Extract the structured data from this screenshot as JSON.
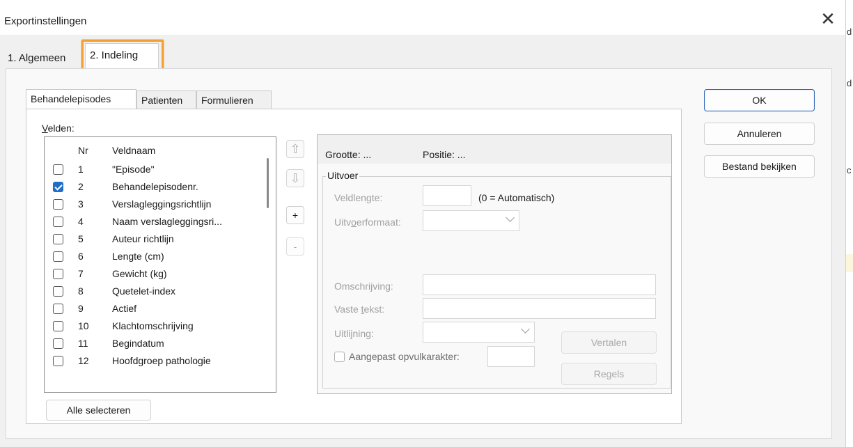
{
  "window": {
    "title": "Exportinstellingen",
    "close_label": "✕"
  },
  "page_tabs": [
    {
      "label": "1. Algemeen"
    },
    {
      "label": "2. Indeling"
    }
  ],
  "inner_tabs": [
    {
      "label": "Behandelepisodes"
    },
    {
      "label": "Patienten"
    },
    {
      "label": "Formulieren"
    }
  ],
  "fields_panel": {
    "label_prefix": "V",
    "label_rest": "elden:",
    "col_nr": "Nr",
    "col_name": "Veldnaam",
    "rows": [
      {
        "nr": "1",
        "name": "\"Episode\"",
        "checked": false
      },
      {
        "nr": "2",
        "name": "Behandelepisodenr.",
        "checked": true
      },
      {
        "nr": "3",
        "name": "Verslagleggingsrichtlijn",
        "checked": false
      },
      {
        "nr": "4",
        "name": "Naam verslagleggingsri...",
        "checked": false
      },
      {
        "nr": "5",
        "name": "Auteur richtlijn",
        "checked": false
      },
      {
        "nr": "6",
        "name": "Lengte (cm)",
        "checked": false
      },
      {
        "nr": "7",
        "name": "Gewicht (kg)",
        "checked": false
      },
      {
        "nr": "8",
        "name": "Quetelet-index",
        "checked": false
      },
      {
        "nr": "9",
        "name": "Actief",
        "checked": false
      },
      {
        "nr": "10",
        "name": "Klachtomschrijving",
        "checked": false
      },
      {
        "nr": "11",
        "name": "Begindatum",
        "checked": false
      },
      {
        "nr": "12",
        "name": "Hoofdgroep pathologie",
        "checked": false
      }
    ],
    "select_all": "Alle selecteren"
  },
  "side_buttons": {
    "up_icon": "⇧",
    "down_icon": "⇩",
    "add": "+",
    "remove": "-"
  },
  "details": {
    "size_label": "Grootte: ...",
    "position_label": "Positie: ...",
    "output_group": "Uitvoer",
    "field_length_label": "Veldlengte:",
    "field_length_hint": "(0 = Automatisch)",
    "output_format_label_a": "Uitv",
    "output_format_label_u": "o",
    "output_format_label_b": "erformaat:",
    "description_label": "Omschrijving:",
    "fixed_text_label_a": "Vaste ",
    "fixed_text_label_u": "t",
    "fixed_text_label_b": "ekst:",
    "alignment_label": "Uitlijning:",
    "padding_label": "Aangepast opvulkarakter:",
    "translate_button": "Vertalen",
    "rules_button": "Regels"
  },
  "actions": {
    "ok": "OK",
    "cancel": "Annuleren",
    "view_file": "Bestand bekijken"
  },
  "background_window": {
    "fragments": [
      "d",
      "d",
      "c"
    ]
  }
}
